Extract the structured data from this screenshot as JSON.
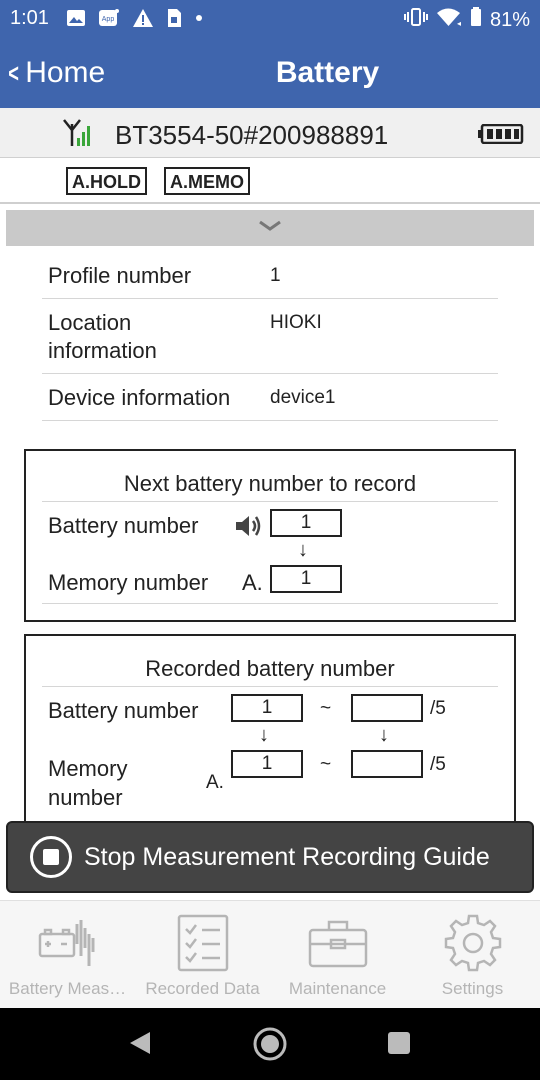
{
  "status_bar": {
    "time": "1:01",
    "battery_percent": "81%",
    "icons": [
      "image-icon",
      "app-notification-icon",
      "warning-icon",
      "sim-icon",
      "dot-icon",
      "vibrate-icon",
      "wifi-icon",
      "battery-icon"
    ]
  },
  "app_bar": {
    "back_label": "Home",
    "title": "Battery"
  },
  "device": {
    "name": "BT3554-50#200988891",
    "signal_icon": "signal-antenna-icon",
    "battery_icon": "battery-level-icon"
  },
  "badges": {
    "hold": "A.HOLD",
    "memo": "A.MEMO"
  },
  "info": {
    "profile_label": "Profile number",
    "profile_value": "1",
    "location_label_1": "Location",
    "location_label_2": "information",
    "location_value": "HIOKI",
    "device_label": "Device information",
    "device_value": "device1"
  },
  "next_record": {
    "title": "Next battery number to record",
    "battery_label": "Battery number",
    "battery_value": "1",
    "memory_label": "Memory number",
    "memory_prefix": "A.",
    "memory_value": "1",
    "arrow": "↓"
  },
  "recorded": {
    "title": "Recorded battery number",
    "battery_label": "Battery number",
    "battery_from": "1",
    "battery_to": "",
    "tilde": "~",
    "total": "/5",
    "memory_label_1": "Memory",
    "memory_label_2": "number",
    "memory_prefix": "A.",
    "memory_from": "1",
    "memory_to": "",
    "arrow": "↓"
  },
  "stop_button": {
    "label": "Stop Measurement Recording Guide"
  },
  "bottom_nav": {
    "items": [
      {
        "label": "Battery Meas…",
        "icon": "battery-measurement-icon"
      },
      {
        "label": "Recorded Data",
        "icon": "clipboard-list-icon"
      },
      {
        "label": "Maintenance",
        "icon": "toolbox-icon"
      },
      {
        "label": "Settings",
        "icon": "gear-icon"
      }
    ]
  },
  "colors": {
    "header": "#3f65ad",
    "stop_button": "#444444",
    "nav_inactive": "#b5b5b5"
  }
}
